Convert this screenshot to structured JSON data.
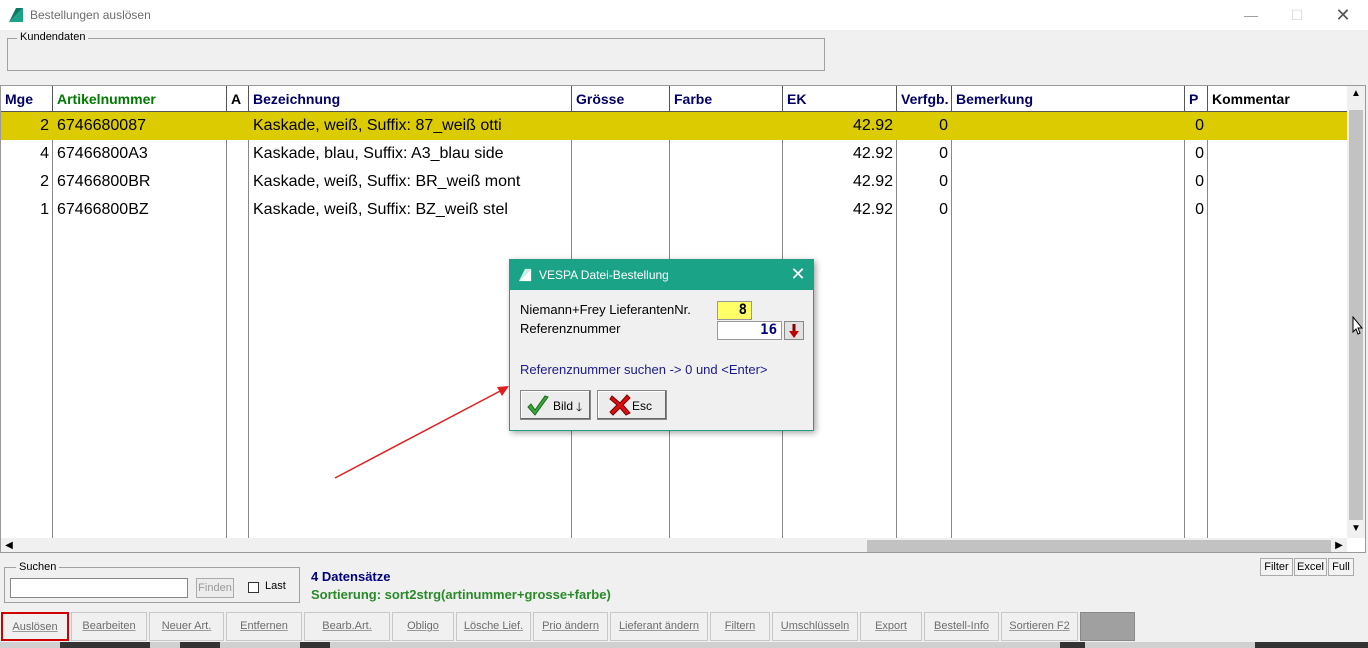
{
  "window": {
    "title": "Bestellungen auslösen",
    "min_glyph": "—",
    "max_glyph": "☐",
    "close_glyph": "✕",
    "accent_color": "#1aa387"
  },
  "kundendaten": {
    "label": "Kundendaten"
  },
  "grid": {
    "columns": [
      "Mge",
      "Artikelnummer",
      "A",
      "Bezeichnung",
      "Grösse",
      "Farbe",
      "EK",
      "Verfgb.",
      "Bemerkung",
      "P",
      "Kommentar"
    ],
    "rows": [
      {
        "mge": "2",
        "artikelnummer": "6746680087",
        "a": "",
        "bezeichnung": "Kaskade, weiß, Suffix: 87_weiß otti",
        "groesse": "",
        "farbe": "",
        "ek": "42.92",
        "verfgb": "0",
        "bemerkung": "",
        "p": "0",
        "kommentar": ""
      },
      {
        "mge": "4",
        "artikelnummer": "67466800A3",
        "a": "",
        "bezeichnung": "Kaskade, blau, Suffix: A3_blau side",
        "groesse": "",
        "farbe": "",
        "ek": "42.92",
        "verfgb": "0",
        "bemerkung": "",
        "p": "0",
        "kommentar": ""
      },
      {
        "mge": "2",
        "artikelnummer": "67466800BR",
        "a": "",
        "bezeichnung": "Kaskade, weiß, Suffix: BR_weiß mont",
        "groesse": "",
        "farbe": "",
        "ek": "42.92",
        "verfgb": "0",
        "bemerkung": "",
        "p": "0",
        "kommentar": ""
      },
      {
        "mge": "1",
        "artikelnummer": "67466800BZ",
        "a": "",
        "bezeichnung": "Kaskade, weiß, Suffix: BZ_weiß stel",
        "groesse": "",
        "farbe": "",
        "ek": "42.92",
        "verfgb": "0",
        "bemerkung": "",
        "p": "0",
        "kommentar": ""
      }
    ],
    "selected_row_color": "#dccb00"
  },
  "dialog": {
    "title": "VESPA Datei-Bestellung",
    "close_glyph": "✕",
    "lieferant_label": "Niemann+Frey LieferantenNr.",
    "lieferant_value": "8",
    "referenz_label": "Referenznummer",
    "referenz_value": "16",
    "hint": "Referenznummer suchen -> 0 und <Enter>",
    "bild_label": "Bild",
    "bild_arrow": "🡓",
    "esc_label": "Esc"
  },
  "search": {
    "label": "Suchen",
    "value": "",
    "finden_label": "Finden",
    "last_label": "Last",
    "last_checked": false
  },
  "status": {
    "count": "4 Datensätze",
    "sort": "Sortierung: sort2strg(artinummer+grosse+farbe)"
  },
  "side_buttons": [
    "Filter",
    "Excel",
    "Full"
  ],
  "toolbar": [
    "Auslösen",
    "Bearbeiten",
    "Neuer Art.",
    "Entfernen",
    "Bearb.Art.",
    "Obligo",
    "Lösche Lief.",
    "Prio ändern",
    "Lieferant ändern",
    "Filtern",
    "Umschlüsseln",
    "Export",
    "Bestell-Info",
    "Sortieren F2"
  ]
}
